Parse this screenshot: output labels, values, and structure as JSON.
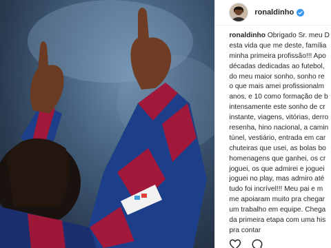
{
  "post": {
    "username": "ronaldinho",
    "verified": true,
    "caption_lines": [
      "Obrigado Sr. meu D",
      "esta vida que me deste, família",
      "minha primeira profissão!!! Apo",
      "décadas dedicadas ao futebol,",
      "do meu maior sonho, sonho re",
      "o que mais amei profissionalm",
      "anos, e 10 como formação de b",
      "intensamente este sonho de cr",
      "instante, viagens, vitórias, derro",
      "resenha, hino nacional, a camin",
      "túnel, vestiário, entrada em car",
      "chuteiras que usei, as bolas bo",
      "homenagens que ganhei, os cr",
      "joguei, os que admirei e joguei",
      "joguei no play, mas admiro até",
      "tudo foi incrível!!! Meu pai e m",
      "me apoiaram muito pra chegar",
      "um trabalho em equipe. Chega",
      "da primeira etapa com uma his",
      "pra contar"
    ]
  },
  "icons": {
    "like": "heart-outline-icon",
    "comment": "comment-bubble-icon",
    "verified": "verified-badge-icon"
  },
  "colors": {
    "verified": "#3897f0",
    "text": "#262626"
  }
}
